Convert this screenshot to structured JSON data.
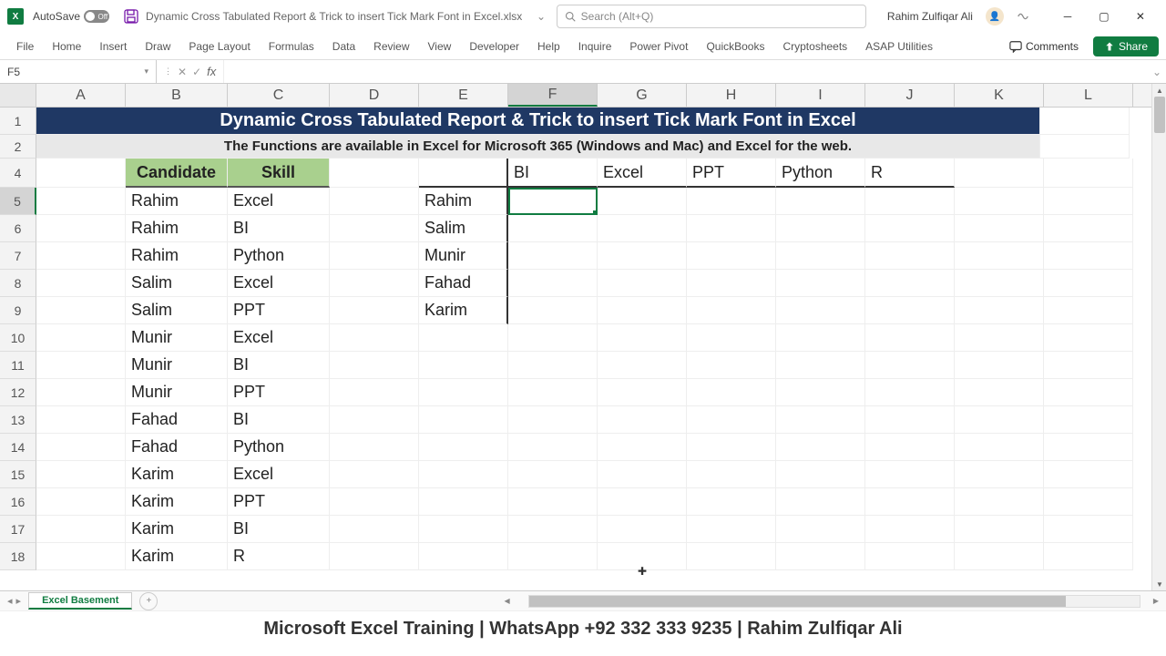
{
  "title": {
    "autosave_label": "AutoSave",
    "autosave_state": "Off",
    "document": "Dynamic Cross Tabulated Report & Trick to insert Tick Mark Font in Excel.xlsx",
    "search_placeholder": "Search (Alt+Q)",
    "user": "Rahim Zulfiqar Ali"
  },
  "ribbon": {
    "tabs": [
      "File",
      "Home",
      "Insert",
      "Draw",
      "Page Layout",
      "Formulas",
      "Data",
      "Review",
      "View",
      "Developer",
      "Help",
      "Inquire",
      "Power Pivot",
      "QuickBooks",
      "Cryptosheets",
      "ASAP Utilities"
    ],
    "comments": "Comments",
    "share": "Share"
  },
  "formula": {
    "name_box": "F5",
    "fx": "fx",
    "value": ""
  },
  "columns": [
    "A",
    "B",
    "C",
    "D",
    "E",
    "F",
    "G",
    "H",
    "I",
    "J",
    "K",
    "L"
  ],
  "selected_col": "F",
  "selected_row": 5,
  "rows_visible": [
    1,
    2,
    4,
    5,
    6,
    7,
    8,
    9,
    10,
    11,
    12,
    13,
    14,
    15,
    16,
    17,
    18
  ],
  "banner1": "Dynamic Cross Tabulated Report & Trick to insert Tick Mark Font in Excel",
  "banner2": "The Functions are available in Excel for Microsoft 365 (Windows and Mac) and Excel for the web.",
  "headers": {
    "B": "Candidate",
    "C": "Skill"
  },
  "data_table": [
    {
      "B": "Rahim",
      "C": "Excel"
    },
    {
      "B": "Rahim",
      "C": "BI"
    },
    {
      "B": "Rahim",
      "C": "Python"
    },
    {
      "B": "Salim",
      "C": "Excel"
    },
    {
      "B": "Salim",
      "C": "PPT"
    },
    {
      "B": "Munir",
      "C": "Excel"
    },
    {
      "B": "Munir",
      "C": "BI"
    },
    {
      "B": "Munir",
      "C": "PPT"
    },
    {
      "B": "Fahad",
      "C": "BI"
    },
    {
      "B": "Fahad",
      "C": "Python"
    },
    {
      "B": "Karim",
      "C": "Excel"
    },
    {
      "B": "Karim",
      "C": "PPT"
    },
    {
      "B": "Karim",
      "C": "BI"
    },
    {
      "B": "Karim",
      "C": "R"
    }
  ],
  "crosstab_cols": [
    "BI",
    "Excel",
    "PPT",
    "Python",
    "R"
  ],
  "crosstab_rows": [
    "Rahim",
    "Salim",
    "Munir",
    "Fahad",
    "Karim"
  ],
  "sheet": {
    "name": "Excel Basement"
  },
  "footer": "Microsoft Excel Training | WhatsApp +92 332 333 9235 | Rahim Zulfiqar Ali"
}
